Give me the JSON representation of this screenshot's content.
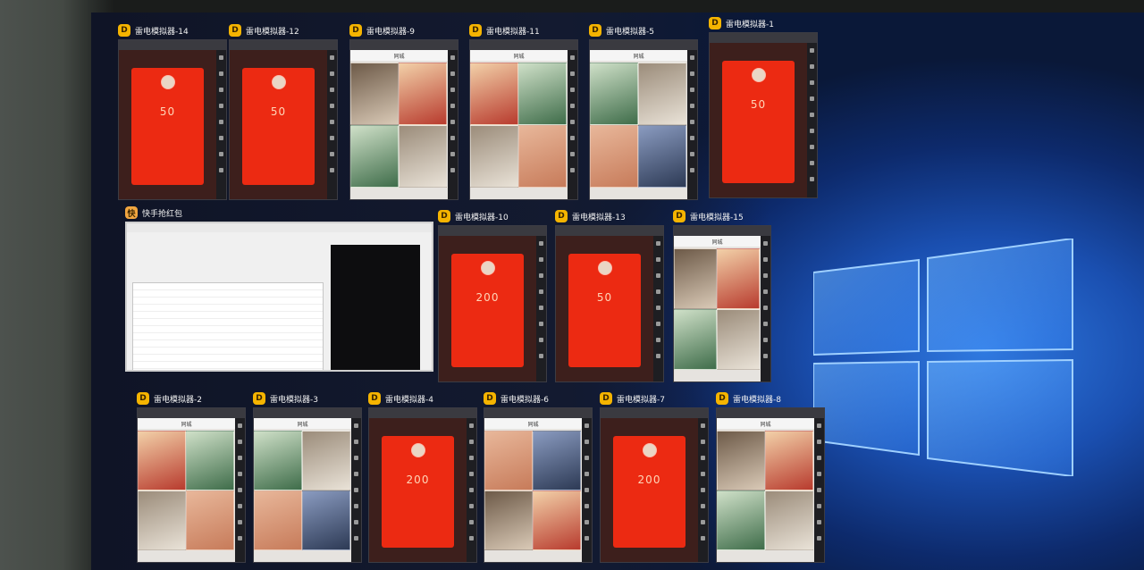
{
  "monitor": {
    "desktop": "windows-10-default-wallpaper"
  },
  "emulator_windows": [
    {
      "title": "雷电模拟器-14",
      "kind": "redpacket",
      "amount": "50"
    },
    {
      "title": "雷电模拟器-12",
      "kind": "redpacket",
      "amount": "50"
    },
    {
      "title": "雷电模拟器-9",
      "kind": "feed"
    },
    {
      "title": "雷电模拟器-11",
      "kind": "feed"
    },
    {
      "title": "雷电模拟器-5",
      "kind": "feed"
    },
    {
      "title": "雷电模拟器-1",
      "kind": "redpacket",
      "amount": "50"
    },
    {
      "title": "雷电模拟器-10",
      "kind": "redpacket",
      "amount": "200"
    },
    {
      "title": "雷电模拟器-13",
      "kind": "redpacket",
      "amount": "50"
    },
    {
      "title": "雷电模拟器-15",
      "kind": "feed"
    },
    {
      "title": "雷电模拟器-2",
      "kind": "feed"
    },
    {
      "title": "雷电模拟器-3",
      "kind": "feed"
    },
    {
      "title": "雷电模拟器-4",
      "kind": "redpacket",
      "amount": "200"
    },
    {
      "title": "雷电模拟器-6",
      "kind": "feed"
    },
    {
      "title": "雷电模拟器-7",
      "kind": "redpacket",
      "amount": "200"
    },
    {
      "title": "雷电模拟器-8",
      "kind": "feed"
    }
  ],
  "tool_window": {
    "title": "快手抢红包"
  },
  "feed_tab_label": "同城",
  "colors": {
    "redpacket": "#ec2a12",
    "app_logo": "#f5b400",
    "wallpaper_blue": "#2f79e0"
  }
}
